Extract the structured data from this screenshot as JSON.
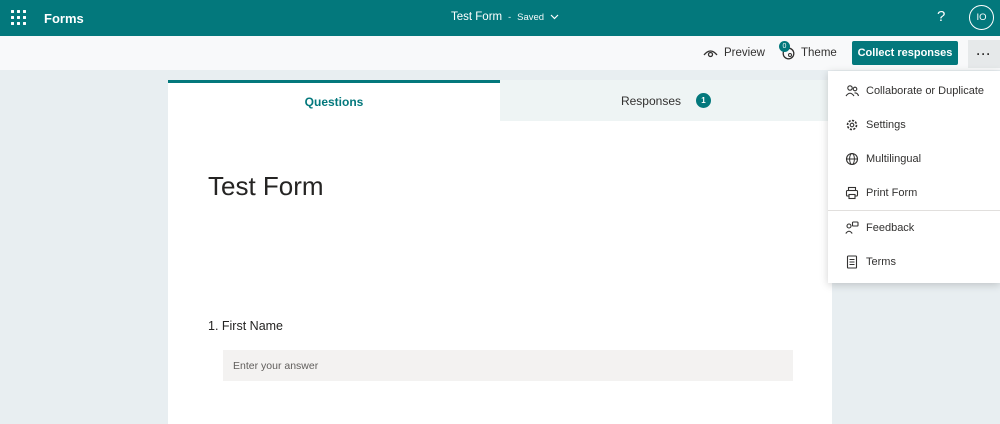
{
  "header": {
    "app_name": "Forms",
    "doc_title": "Test Form",
    "separator": "-",
    "save_status": "Saved",
    "help_label": "?",
    "avatar_initials": "IO"
  },
  "toolbar": {
    "preview_label": "Preview",
    "theme_label": "Theme",
    "theme_badge": "0",
    "collect_label": "Collect responses",
    "more_label": "···"
  },
  "tabs": {
    "questions_label": "Questions",
    "responses_label": "Responses",
    "responses_count": "1"
  },
  "form": {
    "title": "Test Form",
    "question_1_label": "1. First Name",
    "answer_placeholder": "Enter your answer"
  },
  "menu": {
    "items": [
      {
        "label": "Collaborate or Duplicate",
        "icon": "people-icon"
      },
      {
        "label": "Settings",
        "icon": "gear-icon"
      },
      {
        "label": "Multilingual",
        "icon": "globe-icon"
      },
      {
        "label": "Print Form",
        "icon": "printer-icon"
      },
      {
        "label": "Feedback",
        "icon": "feedback-icon"
      },
      {
        "label": "Terms",
        "icon": "document-icon"
      }
    ]
  },
  "colors": {
    "brand": "#03787c",
    "page_bg": "#e8eef1"
  }
}
